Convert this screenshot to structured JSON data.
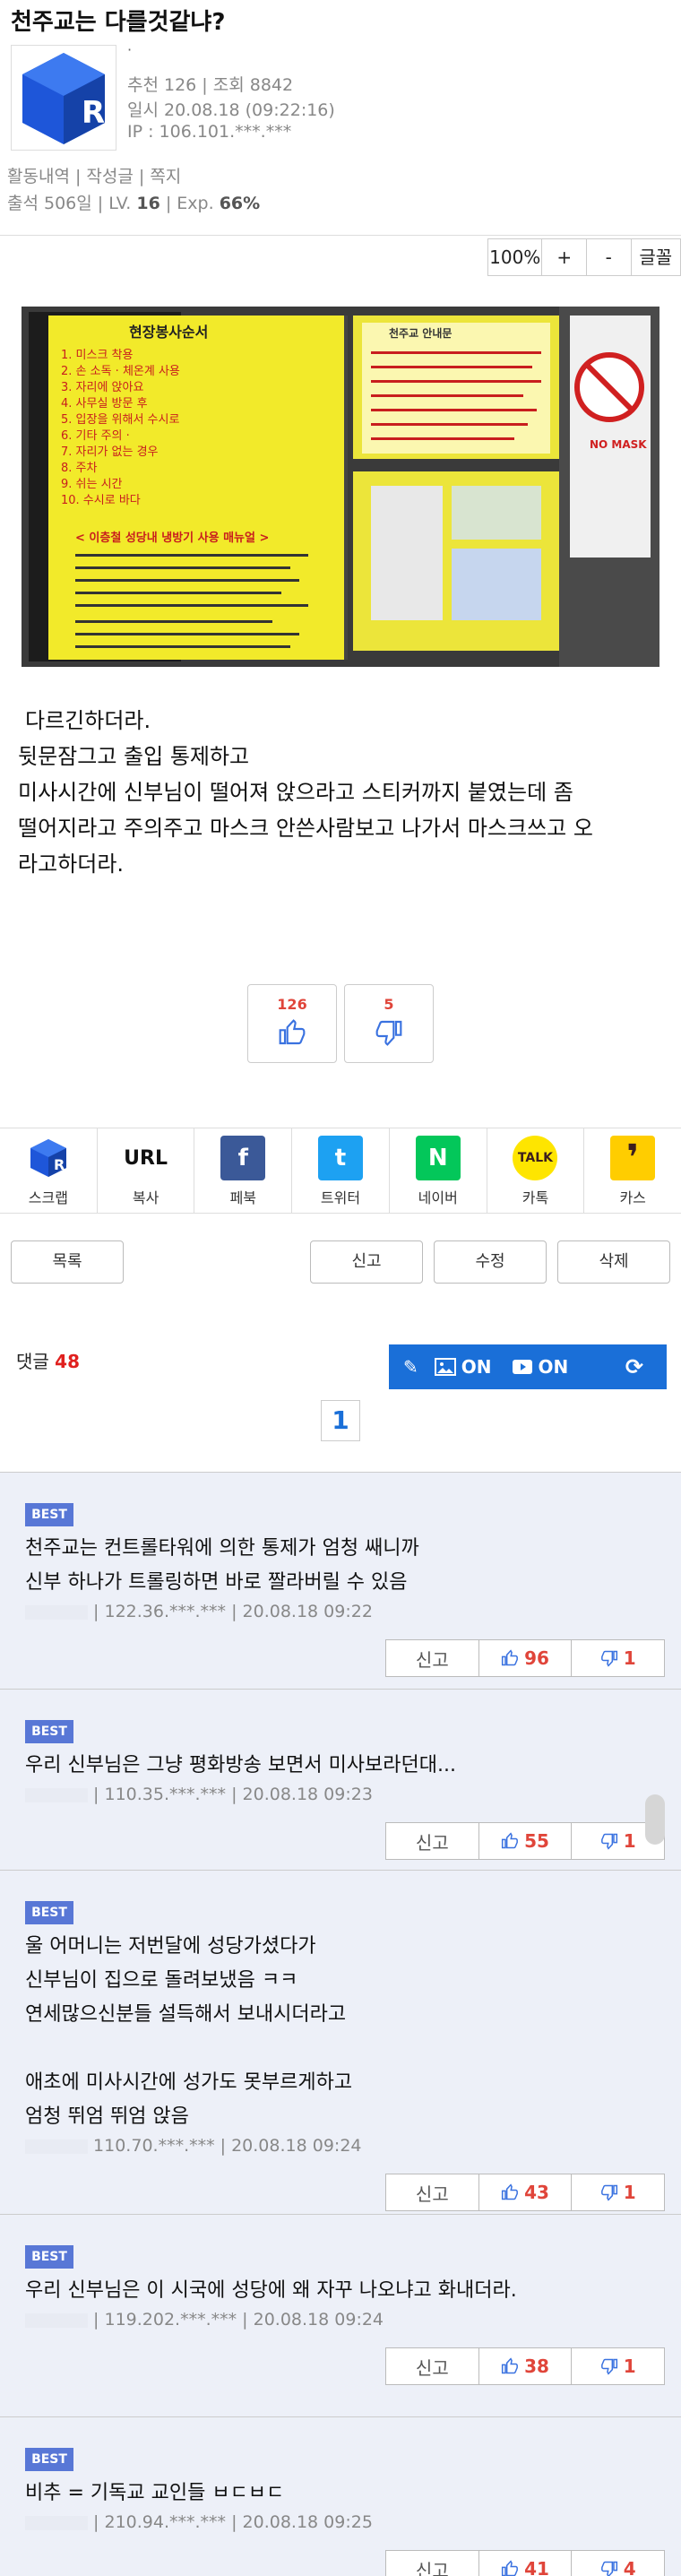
{
  "post": {
    "title": "천주교는 다를것같냐?",
    "dot": "·",
    "stats": "추천 126 | 조회 8842",
    "date": "일시 20.08.18 (09:22:16)",
    "ip": "IP : 106.101.***.***",
    "links": "활동내역 | 작성글 | 쪽지",
    "level_prefix": "출석 506일 | LV.",
    "level": "16",
    "exp_prefix": "| Exp.",
    "exp": "66%",
    "body": [
      "다르긴하더라.",
      "뒷문잠그고 출입 통제하고",
      "미사시간에 신부님이 떨어져 앉으라고 스티커까지 붙였는데 좀",
      "떨어지라고 주의주고 마스크 안쓴사람보고 나가서 마스크쓰고 오",
      "라고하더라."
    ],
    "upvotes": "126",
    "downvotes": "5"
  },
  "zoom": {
    "level": "100%",
    "plus": "+",
    "minus": "-",
    "font": "글꼴"
  },
  "photo_text": {
    "left_title": "현장봉사순서",
    "left_items": [
      "1. 미스크 착용",
      "2. 손 소독 · 체온계 사용",
      "3. 자리에 앉아요 ",
      "4. 사무실 방문 후",
      "5. 입장을 위해서 수시로",
      "6. 기타 주의 ·",
      "7. 자리가 없는 경우",
      "8. 주차",
      "9. 쉬는 시간",
      "10. 수시로 바다"
    ],
    "left_bottom_title": "< 이층철 성당내 냉방기 사용 매뉴얼 >",
    "right_title": "천주교 안내문",
    "mask_text": "NO MASK"
  },
  "share": [
    {
      "label": "스크랩",
      "icon": "scrap-logo-icon",
      "glyph": "R",
      "color": "#1d4fc8"
    },
    {
      "label": "복사",
      "icon": "url-copy-icon",
      "glyph": "URL",
      "color": "#ffffff"
    },
    {
      "label": "페북",
      "icon": "facebook-icon",
      "glyph": "f",
      "color": "#3b5998"
    },
    {
      "label": "트위터",
      "icon": "twitter-icon",
      "glyph": "t",
      "color": "#1da1f2"
    },
    {
      "label": "네이버",
      "icon": "naver-icon",
      "glyph": "N",
      "color": "#03c75a"
    },
    {
      "label": "카톡",
      "icon": "kakaotalk-icon",
      "glyph": "TALK",
      "color": "#fee500"
    },
    {
      "label": "카스",
      "icon": "kakaostory-icon",
      "glyph": "❜",
      "color": "#ffcd00"
    }
  ],
  "actions": {
    "list": "목록",
    "report": "신고",
    "edit": "수정",
    "delete": "삭제"
  },
  "comments_header": {
    "label": "댓글",
    "count": "48",
    "img_on": "ON",
    "video_on": "ON",
    "page": "1"
  },
  "comments": [
    {
      "badge": "BEST",
      "lines": [
        "천주교는 컨트롤타워에 의한 통제가 엄청 쌔니까",
        "신부 하나가 트롤링하면 바로 짤라버릴 수 있음"
      ],
      "meta": "| 122.36.***.*** | 20.08.18 09:22",
      "report": "신고",
      "up": "96",
      "down": "1"
    },
    {
      "badge": "BEST",
      "lines": [
        "우리 신부님은 그냥 평화방송 보면서 미사보라던대..."
      ],
      "meta": "| 110.35.***.*** | 20.08.18 09:23",
      "report": "신고",
      "up": "55",
      "down": "1"
    },
    {
      "badge": "BEST",
      "lines": [
        "울 어머니는 저번달에 성당가셨다가",
        "신부님이 집으로 돌려보냈음 ㅋㅋ",
        "연세많으신분들  설득해서 보내시더라고",
        "",
        "애초에 미사시간에 성가도 못부르게하고",
        "엄청 뛰엄 뛰엄 앉음"
      ],
      "meta": "110.70.***.*** | 20.08.18 09:24",
      "report": "신고",
      "up": "43",
      "down": "1"
    },
    {
      "badge": "BEST",
      "lines": [
        "우리 신부님은 이 시국에 성당에 왜 자꾸 나오냐고 화내더라."
      ],
      "meta": "| 119.202.***.*** | 20.08.18 09:24",
      "report": "신고",
      "up": "38",
      "down": "1"
    },
    {
      "badge": "BEST",
      "lines": [
        "비추 = 기독교 교인들 ㅂㄷㅂㄷ"
      ],
      "meta": "| 210.94.***.*** | 20.08.18 09:25",
      "report": "신고",
      "up": "41",
      "down": "4"
    }
  ]
}
